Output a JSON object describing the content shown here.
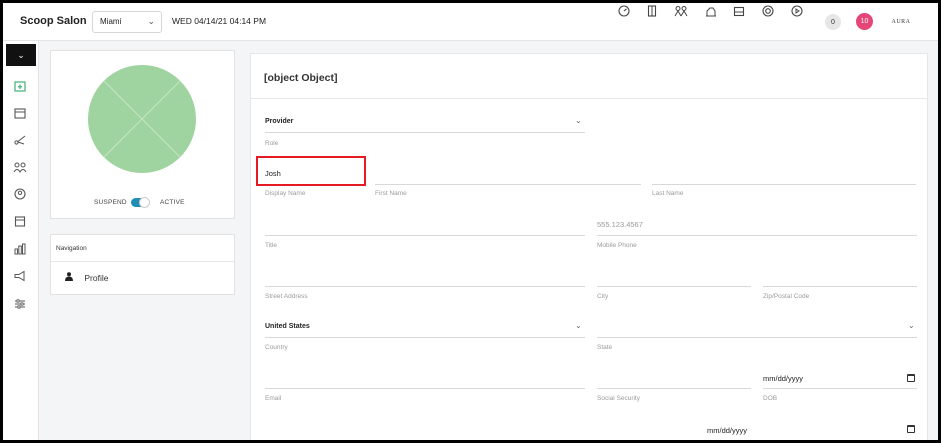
{
  "app": {
    "brand": "Scoop Salon",
    "location": "Miami",
    "datetime": "WED 04/14/21  04:14 PM",
    "notifications_zero": "0",
    "notifications_count": "10",
    "user_logo": "AURA"
  },
  "topbar_icons": [
    "speedometer-icon",
    "door-icon",
    "people-icon",
    "money-bag-icon",
    "inbox-tray-icon",
    "lifebuoy-icon",
    "play-circle-icon"
  ],
  "sidebar": {
    "items": [
      "calendar-add-icon",
      "calendar-icon",
      "scissors-icon",
      "team-icon",
      "account-circle-icon",
      "register-icon",
      "bar-chart-icon",
      "megaphone-icon",
      "settings-sliders-icon"
    ]
  },
  "profile": {
    "suspend_label": "SUSPEND",
    "active_label": "ACTIVE",
    "status_active": true
  },
  "navigation": {
    "title": "Navigation",
    "items": [
      {
        "label": "Profile"
      }
    ]
  },
  "form": {
    "title": {
      "label": "Title"
    },
    "role": {
      "value": "Provider",
      "label": "Role"
    },
    "display_name": {
      "value": "Josh",
      "label": "Display Name"
    },
    "first_name": {
      "label": "First Name"
    },
    "last_name": {
      "label": "Last Name"
    },
    "mobile_phone": {
      "placeholder": "555.123.4567",
      "label": "Mobile Phone"
    },
    "street_address": {
      "label": "Street Address"
    },
    "city": {
      "label": "City"
    },
    "zip": {
      "label": "Zip/Postal Code"
    },
    "country": {
      "value": "United States",
      "label": "Country"
    },
    "state": {
      "label": "State"
    },
    "email": {
      "label": "Email"
    },
    "ssn": {
      "label": "Social Security"
    },
    "dob": {
      "placeholder": "mm/dd/yyyy",
      "label": "DOB"
    },
    "date2": {
      "placeholder": "mm/dd/yyyy"
    }
  },
  "colors": {
    "toggle_on": "#1f8fb7",
    "avatar_fill": "#9fd39f",
    "badge_pink": "#e64578",
    "highlight_red": "#e41b23",
    "active_green": "#2eaa6c"
  }
}
